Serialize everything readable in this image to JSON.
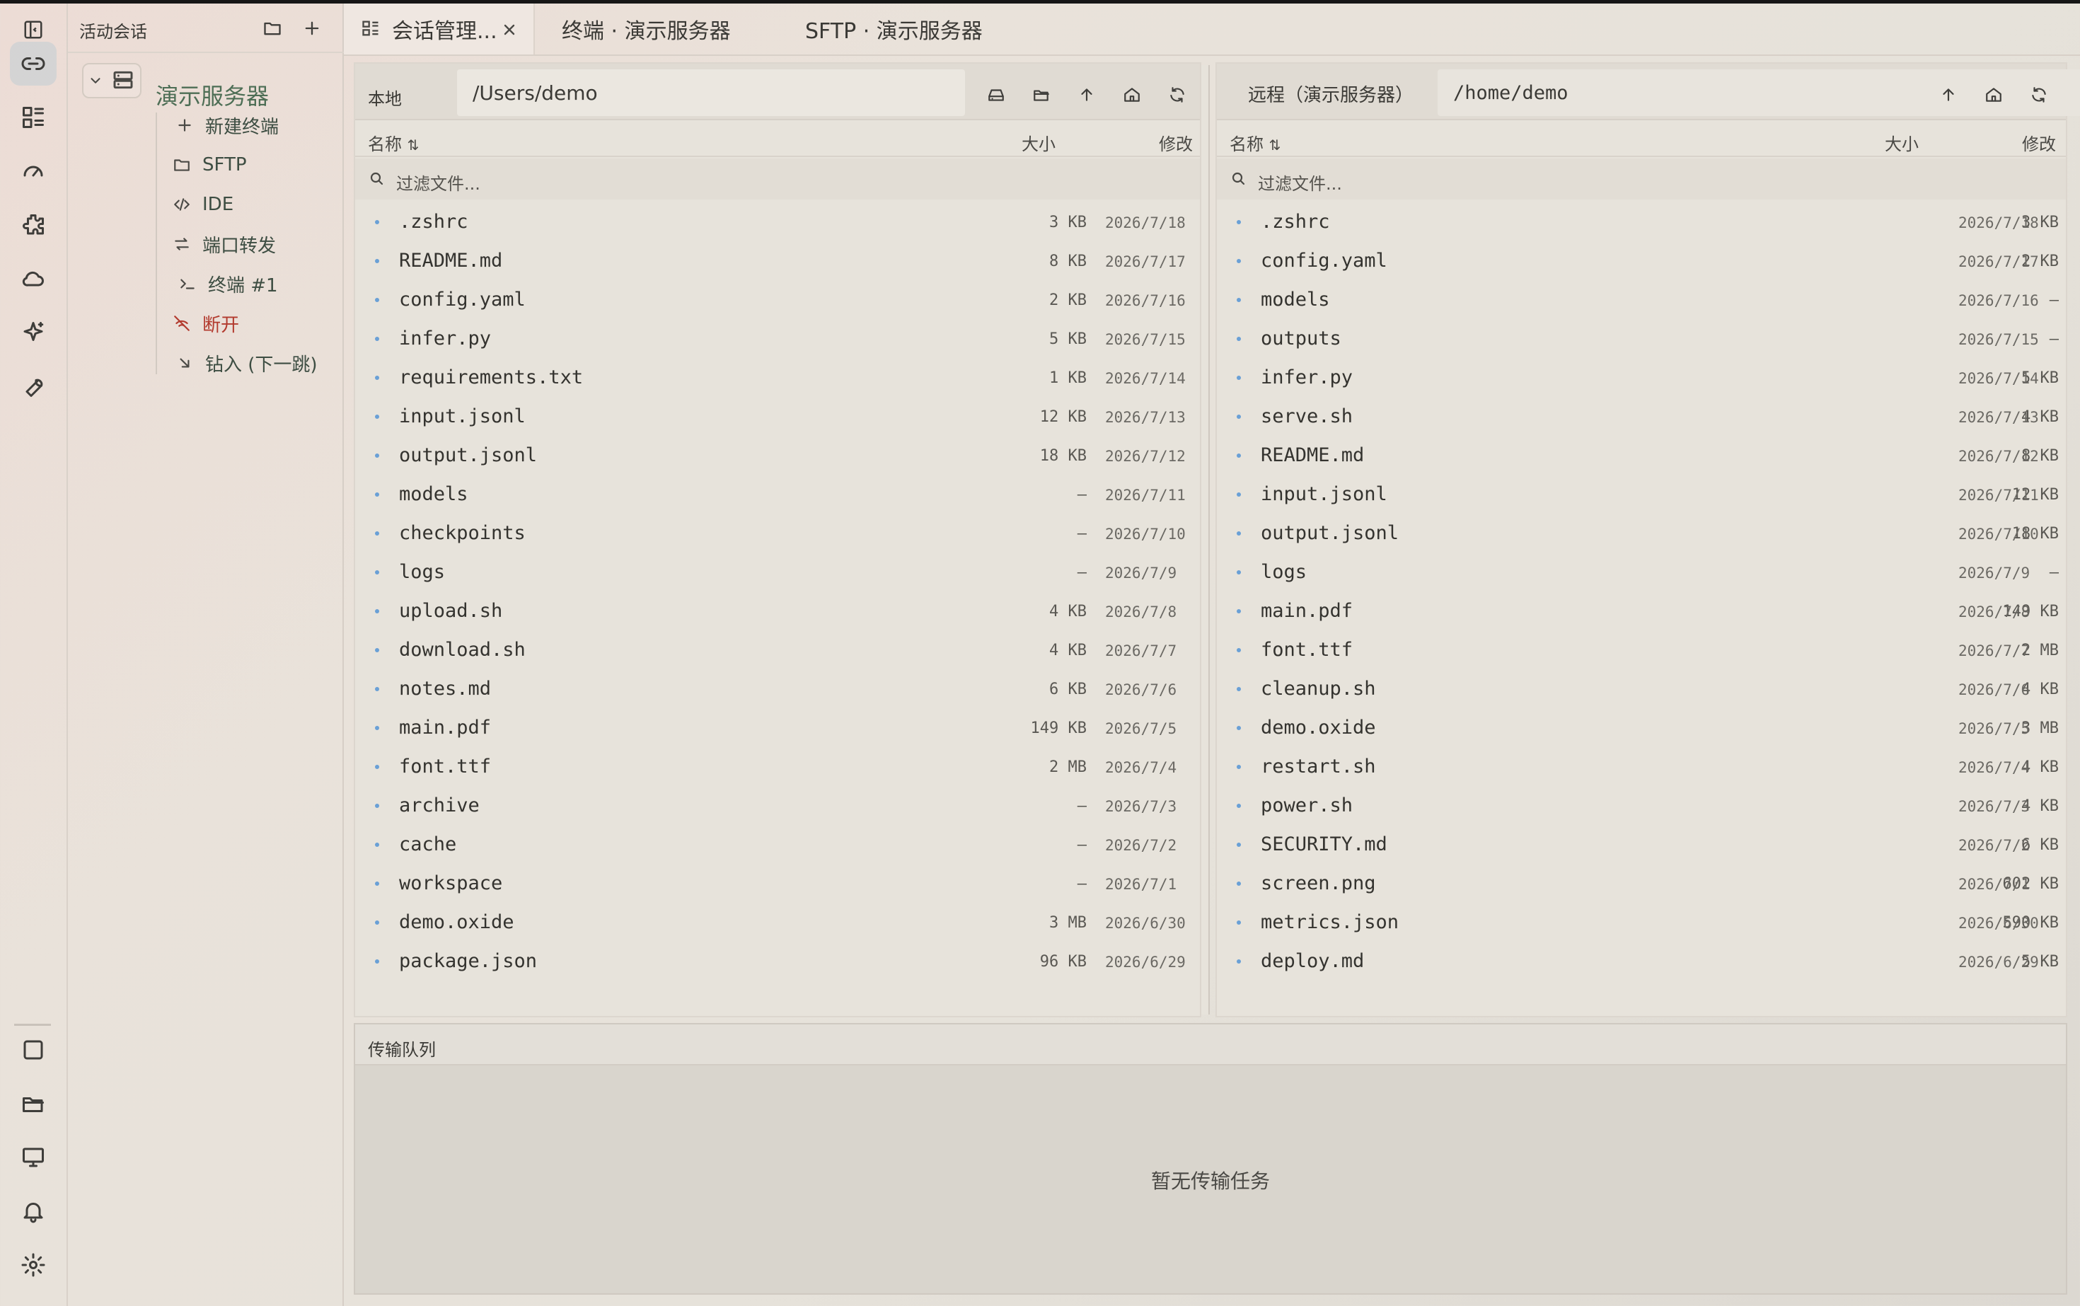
{
  "sidebar": {
    "title": "活动会话",
    "server": "演示服务器",
    "items": [
      {
        "label": "新建终端",
        "icon": "plus-icon"
      },
      {
        "label": "SFTP",
        "icon": "folder-icon"
      },
      {
        "label": "IDE",
        "icon": "code-icon"
      },
      {
        "label": "端口转发",
        "icon": "swap-icon"
      },
      {
        "label": "终端 #1",
        "icon": "terminal-icon"
      },
      {
        "label": "断开",
        "icon": "disconnect-icon"
      },
      {
        "label": "钻入 (下一跳)",
        "icon": "arrow-down-right-icon"
      }
    ]
  },
  "tabs": [
    {
      "label": "会话管理...",
      "icon": "grid-icon"
    },
    {
      "label": "终端 · 演示服务器"
    },
    {
      "label": "SFTP · 演示服务器"
    }
  ],
  "local": {
    "label": "本地",
    "path": "/Users/demo",
    "col_name": "名称",
    "col_size": "大小",
    "col_modified": "修改",
    "filter_placeholder": "过滤文件...",
    "files": [
      {
        "name": ".zshrc",
        "size": "3 KB",
        "date": "2026/7/18"
      },
      {
        "name": "README.md",
        "size": "8 KB",
        "date": "2026/7/17"
      },
      {
        "name": "config.yaml",
        "size": "2 KB",
        "date": "2026/7/16"
      },
      {
        "name": "infer.py",
        "size": "5 KB",
        "date": "2026/7/15"
      },
      {
        "name": "requirements.txt",
        "size": "1 KB",
        "date": "2026/7/14"
      },
      {
        "name": "input.jsonl",
        "size": "12 KB",
        "date": "2026/7/13"
      },
      {
        "name": "output.jsonl",
        "size": "18 KB",
        "date": "2026/7/12"
      },
      {
        "name": "models",
        "size": "—",
        "date": "2026/7/11"
      },
      {
        "name": "checkpoints",
        "size": "—",
        "date": "2026/7/10"
      },
      {
        "name": "logs",
        "size": "—",
        "date": "2026/7/9"
      },
      {
        "name": "upload.sh",
        "size": "4 KB",
        "date": "2026/7/8"
      },
      {
        "name": "download.sh",
        "size": "4 KB",
        "date": "2026/7/7"
      },
      {
        "name": "notes.md",
        "size": "6 KB",
        "date": "2026/7/6"
      },
      {
        "name": "main.pdf",
        "size": "149 KB",
        "date": "2026/7/5"
      },
      {
        "name": "font.ttf",
        "size": "2 MB",
        "date": "2026/7/4"
      },
      {
        "name": "archive",
        "size": "—",
        "date": "2026/7/3"
      },
      {
        "name": "cache",
        "size": "—",
        "date": "2026/7/2"
      },
      {
        "name": "workspace",
        "size": "—",
        "date": "2026/7/1"
      },
      {
        "name": "demo.oxide",
        "size": "3 MB",
        "date": "2026/6/30"
      },
      {
        "name": "package.json",
        "size": "96 KB",
        "date": "2026/6/29"
      }
    ]
  },
  "remote": {
    "label": "远程（演示服务器）",
    "path": "/home/demo",
    "col_name": "名称",
    "col_size": "大小",
    "col_modified": "修改",
    "filter_placeholder": "过滤文件...",
    "files": [
      {
        "name": ".zshrc",
        "size": "3 KB",
        "date": "2026/7/18"
      },
      {
        "name": "config.yaml",
        "size": "2 KB",
        "date": "2026/7/17"
      },
      {
        "name": "models",
        "size": "—",
        "date": "2026/7/16"
      },
      {
        "name": "outputs",
        "size": "—",
        "date": "2026/7/15"
      },
      {
        "name": "infer.py",
        "size": "5 KB",
        "date": "2026/7/14"
      },
      {
        "name": "serve.sh",
        "size": "4 KB",
        "date": "2026/7/13"
      },
      {
        "name": "README.md",
        "size": "8 KB",
        "date": "2026/7/12"
      },
      {
        "name": "input.jsonl",
        "size": "12 KB",
        "date": "2026/7/11"
      },
      {
        "name": "output.jsonl",
        "size": "18 KB",
        "date": "2026/7/10"
      },
      {
        "name": "logs",
        "size": "—",
        "date": "2026/7/9"
      },
      {
        "name": "main.pdf",
        "size": "149 KB",
        "date": "2026/7/8"
      },
      {
        "name": "font.ttf",
        "size": "2 MB",
        "date": "2026/7/7"
      },
      {
        "name": "cleanup.sh",
        "size": "4 KB",
        "date": "2026/7/6"
      },
      {
        "name": "demo.oxide",
        "size": "3 MB",
        "date": "2026/7/5"
      },
      {
        "name": "restart.sh",
        "size": "4 KB",
        "date": "2026/7/4"
      },
      {
        "name": "power.sh",
        "size": "4 KB",
        "date": "2026/7/3"
      },
      {
        "name": "SECURITY.md",
        "size": "6 KB",
        "date": "2026/7/2"
      },
      {
        "name": "screen.png",
        "size": "602 KB",
        "date": "2026/7/1"
      },
      {
        "name": "metrics.json",
        "size": "590 KB",
        "date": "2026/6/30"
      },
      {
        "name": "deploy.md",
        "size": "5 KB",
        "date": "2026/6/29"
      }
    ]
  },
  "queue": {
    "title": "传输队列",
    "empty": "暂无传输任务"
  }
}
